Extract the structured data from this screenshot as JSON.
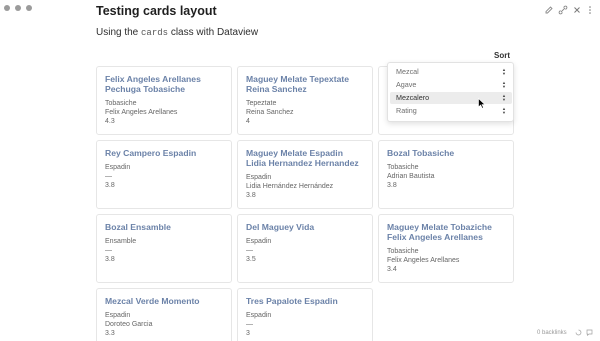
{
  "window": {
    "title": "Testing cards layout"
  },
  "subtitle": {
    "prefix": "Using the ",
    "code": "cards",
    "suffix": " class with Dataview"
  },
  "sort": {
    "label": "Sort",
    "options": [
      "Mezcal",
      "Agave",
      "Mezcalero",
      "Rating"
    ],
    "selected": "Mezcalero"
  },
  "cards": [
    {
      "title": "Felix Angeles Arellanes Pechuga Tobasiche",
      "lines": [
        "Tobasiche",
        "Felix Angeles Arellanes",
        "4.3"
      ]
    },
    {
      "title": "Maguey Melate Tepextate Reina Sanchez",
      "lines": [
        "Tepeztate",
        "Reina Sanchez",
        "4"
      ]
    },
    {
      "title": "Rey Campero Espadin",
      "lines": [
        "Espadin",
        "—",
        "3.8"
      ]
    },
    {
      "title": "Maguey Melate Espadin Lidia Hernandez Hernandez",
      "lines": [
        "Espadin",
        "Lidia Hernández Hernández",
        "3.8"
      ]
    },
    {
      "title": "Bozal Tobasiche",
      "lines": [
        "Tobasiche",
        "Adrian Bautista",
        "3.8"
      ]
    },
    {
      "title": "Bozal Ensamble",
      "lines": [
        "Ensamble",
        "—",
        "3.8"
      ]
    },
    {
      "title": "Del Maguey Vida",
      "lines": [
        "Espadin",
        "—",
        "3.5"
      ]
    },
    {
      "title": "Maguey Melate Tobaziche Felix Angeles Arellanes",
      "lines": [
        "Tobasiche",
        "Felix Angeles Arellanes",
        "3.4"
      ]
    },
    {
      "title": "Mezcal Verde Momento",
      "lines": [
        "Espadin",
        "Doroteo Garcia",
        "3.3"
      ]
    },
    {
      "title": "Tres Papalote Espadin",
      "lines": [
        "Espadin",
        "—",
        "3"
      ]
    }
  ],
  "status": {
    "backlinks": "0 backlinks"
  },
  "icons": [
    "edit-icon",
    "link-icon",
    "close-icon",
    "more-icon",
    "backlinks-icon",
    "chat-icon"
  ]
}
